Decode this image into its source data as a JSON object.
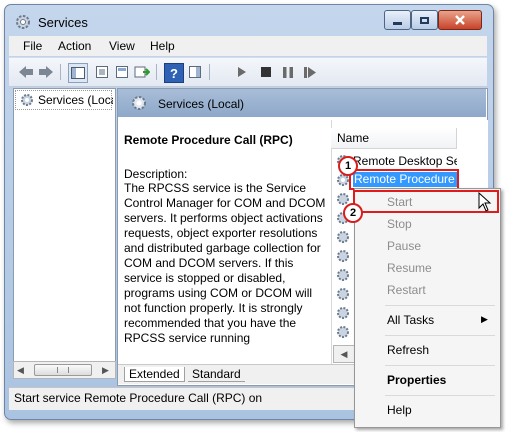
{
  "window": {
    "title": "Services"
  },
  "menubar": [
    "File",
    "Action",
    "View",
    "Help"
  ],
  "toolbar": {
    "icons": [
      "back-icon",
      "forward-icon",
      "show-tree-icon",
      "export-list-icon",
      "properties-icon",
      "refresh-icon",
      "help-icon",
      "show-action-pane-icon",
      "play-icon",
      "stop-icon",
      "pause-icon",
      "restart-icon"
    ]
  },
  "tree": {
    "item": "Services (Local"
  },
  "main": {
    "title": "Services (Local)",
    "service_title": "Remote Procedure Call (RPC)",
    "description_label": "Description:",
    "description": "The RPCSS service is the Service Control Manager for COM and DCOM servers. It performs object activations requests, object exporter resolutions and distributed garbage collection for COM and DCOM servers. If this service is stopped or disabled, programs using COM or DCOM will not function properly. It is strongly recommended that you have the RPCSS service running",
    "column": "Name",
    "rows": [
      "Remote Desktop Ser",
      "Remote Procedure C"
    ],
    "tabs": [
      "Extended",
      "Standard"
    ]
  },
  "context_menu": {
    "items": [
      {
        "label": "Start",
        "enabled": false
      },
      {
        "label": "Stop",
        "enabled": false
      },
      {
        "label": "Pause",
        "enabled": false
      },
      {
        "label": "Resume",
        "enabled": false
      },
      {
        "label": "Restart",
        "enabled": false
      },
      {
        "label": "All Tasks",
        "enabled": true
      },
      {
        "label": "Refresh",
        "enabled": true
      },
      {
        "label": "Properties",
        "enabled": true
      },
      {
        "label": "Help",
        "enabled": true
      }
    ]
  },
  "callouts": [
    "1",
    "2"
  ],
  "status": "Start service Remote Procedure Call (RPC) on",
  "colors": {
    "annotation_red": "#e01b1b",
    "header_blue": "#8ea8c9"
  }
}
